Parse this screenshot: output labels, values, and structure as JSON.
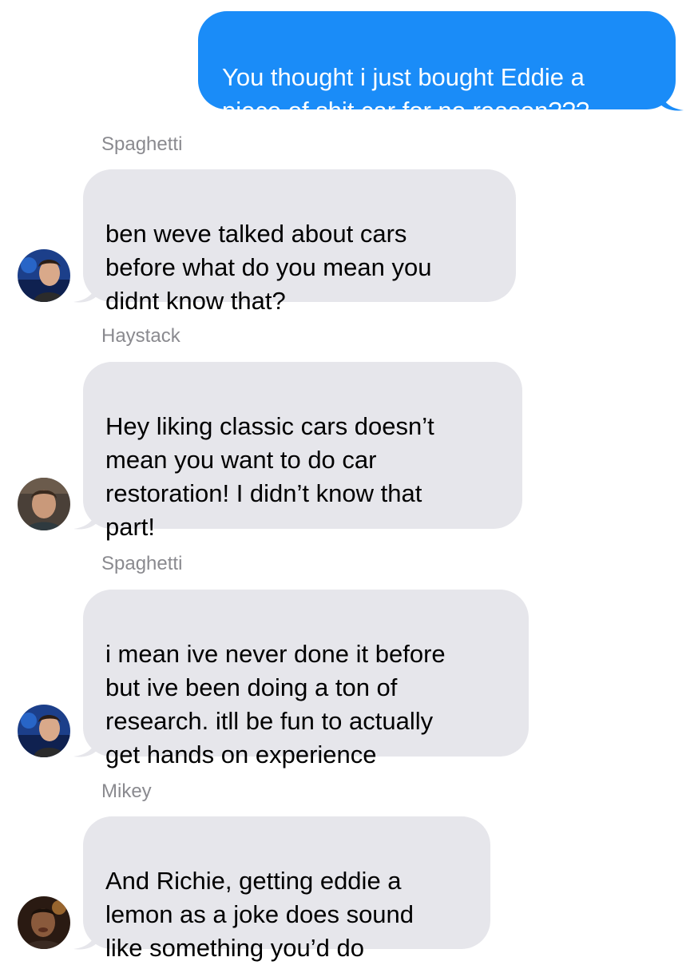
{
  "messages": [
    {
      "type": "sent",
      "text": "You thought i just bought Eddie a\npiece of shit car for no reason???"
    },
    {
      "type": "received",
      "sender": "Spaghetti",
      "text": "ben weve talked about cars\nbefore what do you mean you\ndidnt know that?"
    },
    {
      "type": "received",
      "sender": "Haystack",
      "text": "Hey liking classic cars doesn’t\nmean you want to do car\nrestoration! I didn’t know that\npart!"
    },
    {
      "type": "received",
      "sender": "Spaghetti",
      "text": "i mean ive never done it before\nbut ive been doing a ton of\nresearch. itll be fun to actually\nget hands on experience"
    },
    {
      "type": "received",
      "sender": "Mikey",
      "text": "And Richie, getting eddie a\nlemon as a joke does sound\nlike something you’d do"
    }
  ],
  "colors": {
    "sent_bubble": "#1a8cf8",
    "received_bubble": "#e6e6eb",
    "sender_name": "#8a8a8f"
  }
}
